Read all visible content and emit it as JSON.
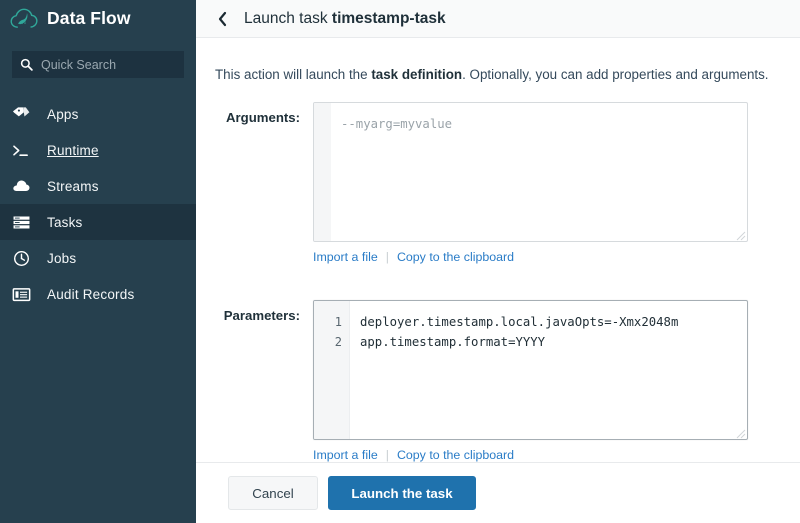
{
  "brand": {
    "title": "Data Flow",
    "logo_icon": "spring-cloud-leaf-icon",
    "logo_color": "#30a89a"
  },
  "search": {
    "placeholder": "Quick Search",
    "value": "",
    "icon": "search-icon"
  },
  "sidebar": {
    "items": [
      {
        "label": "Apps",
        "icon": "tags-icon",
        "state": "normal"
      },
      {
        "label": "Runtime",
        "icon": "terminal-icon",
        "state": "hovered"
      },
      {
        "label": "Streams",
        "icon": "cloud-icon",
        "state": "normal"
      },
      {
        "label": "Tasks",
        "icon": "server-rack-icon",
        "state": "active"
      },
      {
        "label": "Jobs",
        "icon": "clock-icon",
        "state": "normal"
      },
      {
        "label": "Audit Records",
        "icon": "list-card-icon",
        "state": "normal"
      }
    ]
  },
  "header": {
    "back_icon": "chevron-left-icon",
    "title_prefix": "Launch task ",
    "title_target": "timestamp-task"
  },
  "content": {
    "intro_before": "This action will launch the ",
    "intro_bold": "task definition",
    "intro_after": ". Optionally, you can add properties and arguments."
  },
  "arguments_field": {
    "label": "Arguments:",
    "value": "",
    "placeholder": "--myarg=myvalue",
    "gutter_lines": [],
    "import_link": "Import a file",
    "separator": "|",
    "copy_link": "Copy to the clipboard"
  },
  "parameters_field": {
    "label": "Parameters:",
    "lines": [
      "deployer.timestamp.local.javaOpts=-Xmx2048m",
      "app.timestamp.format=YYYY"
    ],
    "gutter_lines": [
      "1",
      "2"
    ],
    "import_link": "Import a file",
    "separator": "|",
    "copy_link": "Copy to the clipboard"
  },
  "footer": {
    "cancel_label": "Cancel",
    "launch_label": "Launch the task"
  },
  "colors": {
    "sidebar_bg": "#26404e",
    "sidebar_active": "#1e3340",
    "primary_button": "#1f72ad",
    "link": "#2a7cc7",
    "brand_teal": "#30a89a"
  }
}
